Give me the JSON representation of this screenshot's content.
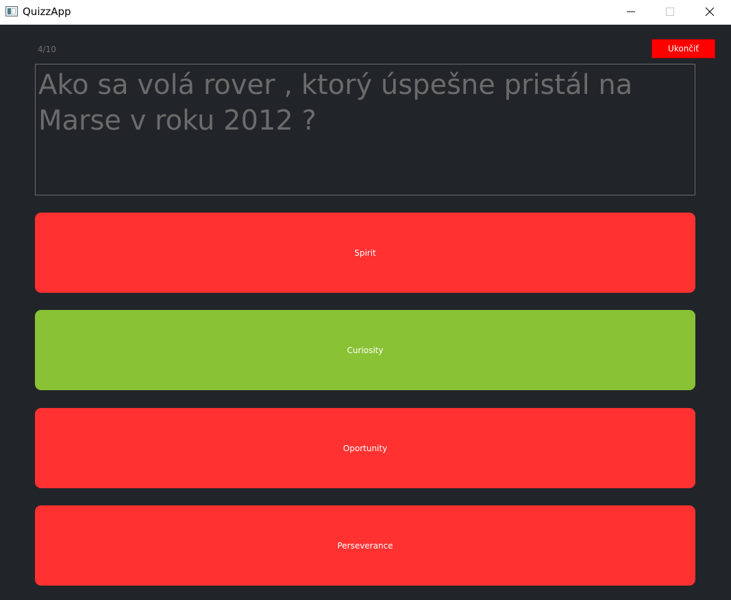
{
  "window": {
    "title": "QuizzApp",
    "buttons": [
      "minimize",
      "maximize",
      "close"
    ]
  },
  "quiz": {
    "progress": "4/10",
    "quit_label": "Ukončiť",
    "question": "Ako sa volá rover , ktorý úspešne pristál na Marse v roku 2012 ?",
    "answers": [
      {
        "label": "Spirit",
        "status": "wrong",
        "color": "#ff3131"
      },
      {
        "label": "Curiosity",
        "status": "correct",
        "color": "#89c234"
      },
      {
        "label": "Oportunity",
        "status": "wrong",
        "color": "#ff3131"
      },
      {
        "label": "Perseverance",
        "status": "wrong",
        "color": "#ff3131"
      }
    ]
  },
  "colors": {
    "background": "#212529",
    "quit_button": "#ff0000",
    "question_text": "#6b6b6b",
    "wrong": "#ff3131",
    "correct": "#89c234"
  }
}
